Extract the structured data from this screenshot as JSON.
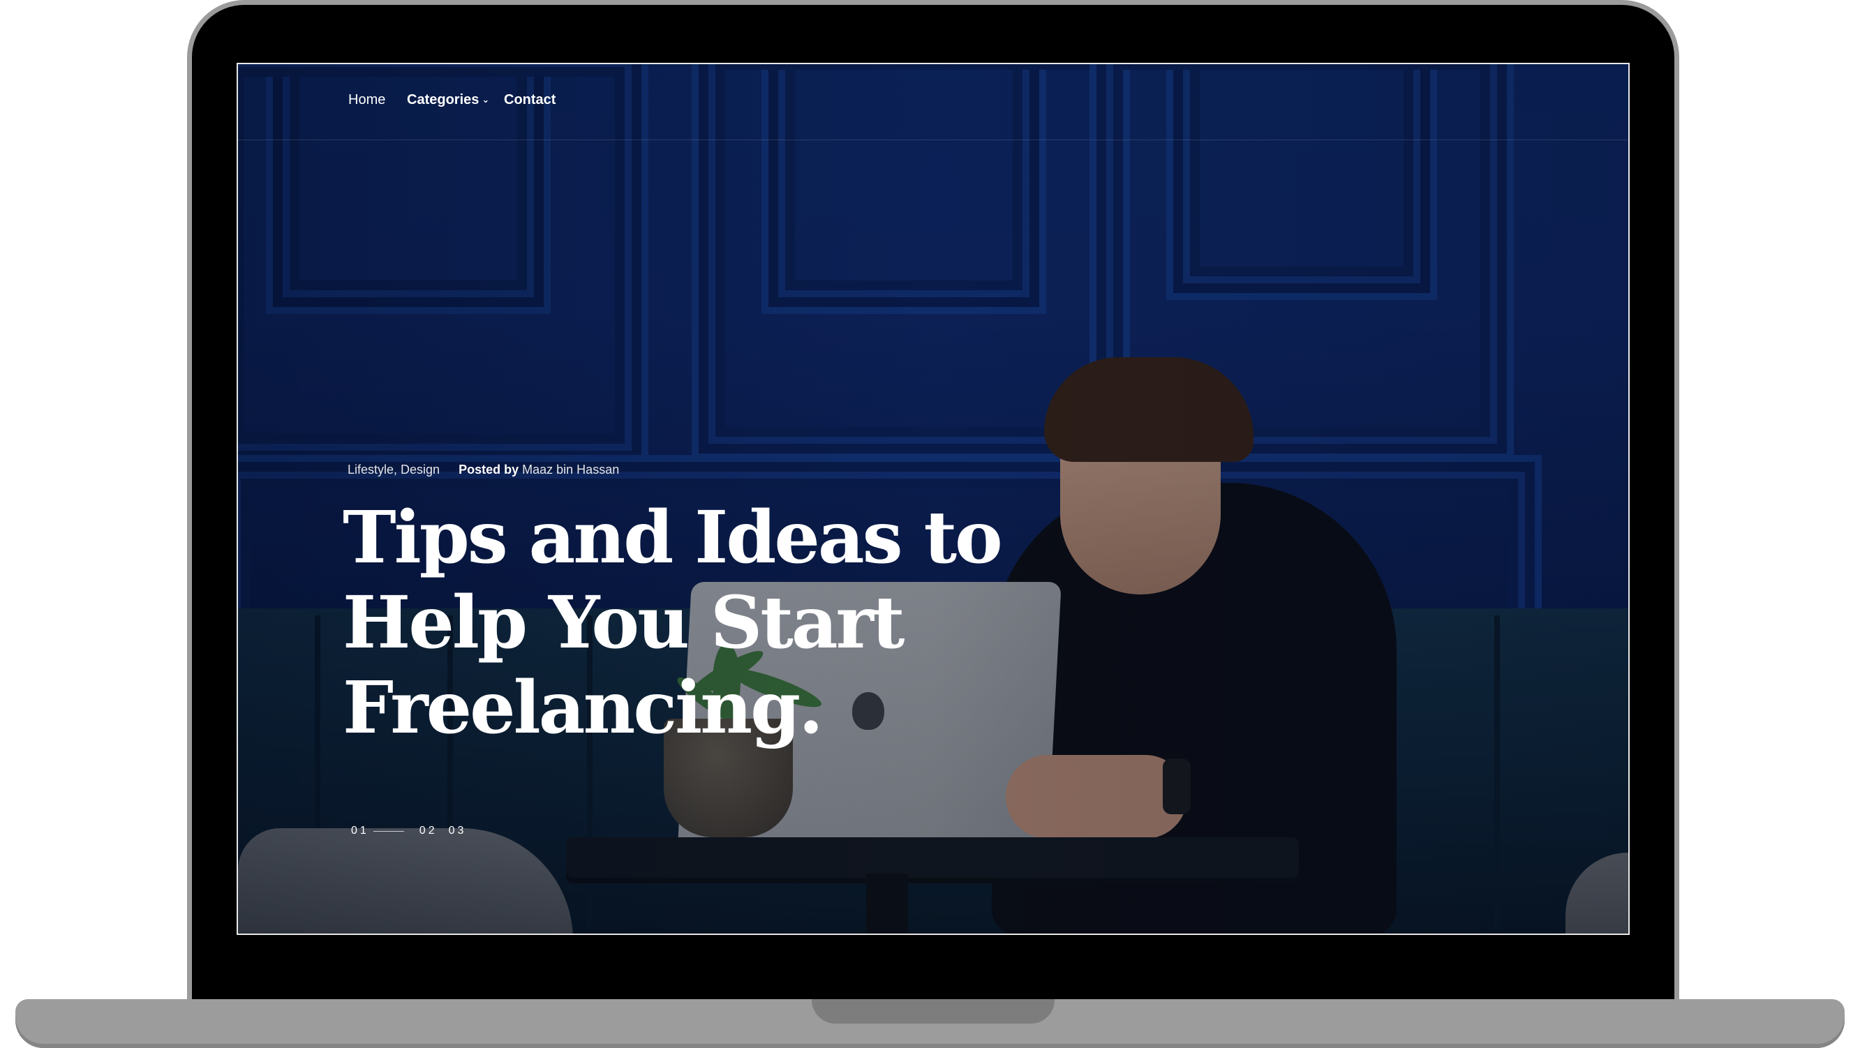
{
  "nav": {
    "home": "Home",
    "categories": "Categories",
    "contact": "Contact"
  },
  "hero": {
    "categories": "Lifestyle, Design",
    "posted_by_label": "Posted by",
    "author": "Maaz bin Hassan",
    "title_lines": [
      "Tips and Ideas to",
      "Help You Start",
      "Freelancing."
    ]
  },
  "slider": {
    "slides": [
      "01",
      "02",
      "03"
    ],
    "active": "01"
  },
  "icons": {
    "categories_caret": "chevron-down-icon"
  },
  "colors": {
    "nav_text": "#ffffff",
    "headline": "#ffffff",
    "background_tint": "#0e2a6a"
  }
}
